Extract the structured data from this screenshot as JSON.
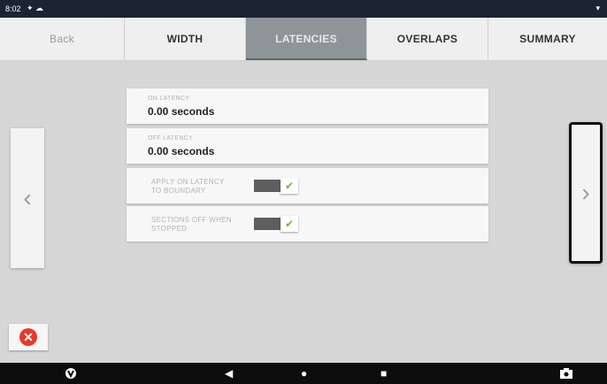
{
  "status_bar": {
    "time": "8:02",
    "icons": "✦ ☁",
    "wifi_icon": "▾"
  },
  "tabs": [
    {
      "label": "Back"
    },
    {
      "label": "WIDTH"
    },
    {
      "label": "LATENCIES"
    },
    {
      "label": "OVERLAPS"
    },
    {
      "label": "SUMMARY"
    }
  ],
  "active_tab": "LATENCIES",
  "nav": {
    "prev_glyph": "‹",
    "next_glyph": "›"
  },
  "fields": {
    "on_latency": {
      "label": "ON LATENCY",
      "value": "0.00 seconds"
    },
    "off_latency": {
      "label": "OFF LATENCY",
      "value": "0.00 seconds"
    }
  },
  "toggles": {
    "apply_on_latency": {
      "label_line1": "APPLY ON LATENCY",
      "label_line2": "TO BOUNDARY",
      "checked": true
    },
    "sections_off": {
      "label_line1": "SECTIONS OFF WHEN",
      "label_line2": "STOPPED",
      "checked": true
    }
  },
  "bottom_nav": {
    "back": "◀",
    "home": "●",
    "recents": "■"
  },
  "colors": {
    "active_tab": "#8e9599",
    "cancel": "#e8392c",
    "toggle_check": "#66bb33"
  }
}
